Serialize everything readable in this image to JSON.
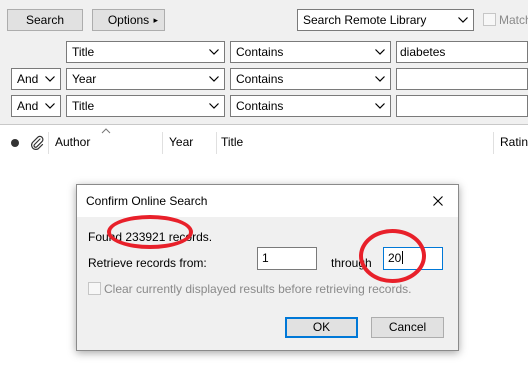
{
  "toolbar": {
    "search_label": "Search",
    "options_label": "Options",
    "options_arrow": "▸",
    "library_select": "Search Remote Library",
    "match_label": "Match"
  },
  "search_rows": [
    {
      "connector": "",
      "field": "Title",
      "operator": "Contains",
      "value": "diabetes"
    },
    {
      "connector": "And",
      "field": "Year",
      "operator": "Contains",
      "value": ""
    },
    {
      "connector": "And",
      "field": "Title",
      "operator": "Contains",
      "value": ""
    }
  ],
  "columns": {
    "author": "Author",
    "year": "Year",
    "title": "Title",
    "rating": "Ratin"
  },
  "dialog": {
    "title": "Confirm Online Search",
    "found_text": "Found 233921 records.",
    "retrieve_label": "Retrieve records from:",
    "from_value": "1",
    "through_label": "through",
    "to_value": "20",
    "clear_label": "Clear currently displayed results before retrieving records.",
    "ok_label": "OK",
    "cancel_label": "Cancel"
  },
  "colors": {
    "annotation": "#e8202a",
    "focus_blue": "#0078d7",
    "panel_bg": "#f0f0f0"
  }
}
